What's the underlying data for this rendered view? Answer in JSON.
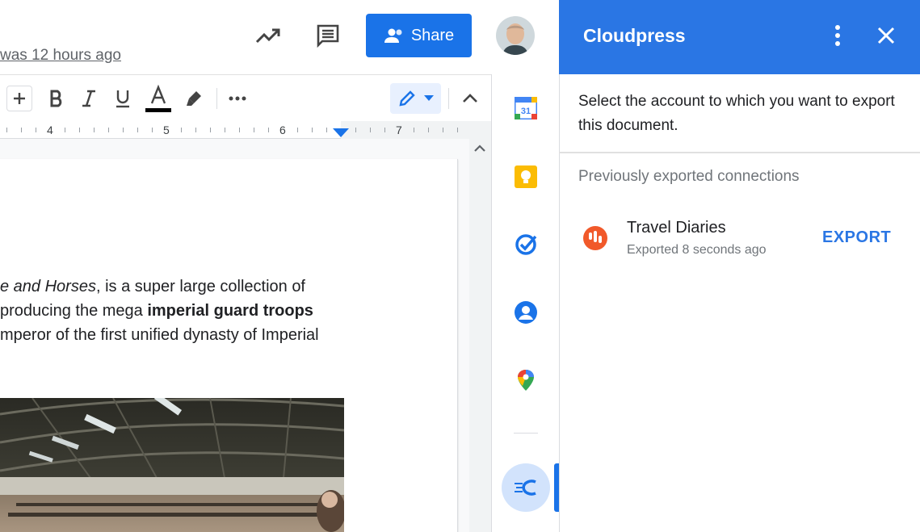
{
  "header": {
    "last_edit": "was 12 hours ago",
    "share_label": "Share"
  },
  "ruler": {
    "marks": [
      "4",
      "5",
      "6",
      "7"
    ]
  },
  "document": {
    "lines": [
      {
        "pre": "",
        "ital": "e and Horses",
        "post": ", is a super large collection of",
        "bold": ""
      },
      {
        "pre": "producing the mega ",
        "ital": "",
        "post": "",
        "bold": "imperial guard troops"
      },
      {
        "pre": "mperor of the first unified dynasty of Imperial",
        "ital": "",
        "post": "",
        "bold": ""
      }
    ]
  },
  "side_apps": {
    "calendar_day": "31",
    "items": [
      "calendar-icon",
      "keep-icon",
      "tasks-icon",
      "contacts-icon",
      "maps-icon",
      "cloudpress-icon"
    ]
  },
  "cloudpress": {
    "title": "Cloudpress",
    "intro": "Select the account to which you want to export this document.",
    "section": "Previously exported connections",
    "connection": {
      "name": "Travel Diaries",
      "time": "Exported 8 seconds ago",
      "action": "EXPORT"
    }
  },
  "colors": {
    "share_blue": "#1a73e8",
    "cloudpress_blue": "#2a76e4",
    "connection_orange": "#f1592a"
  }
}
